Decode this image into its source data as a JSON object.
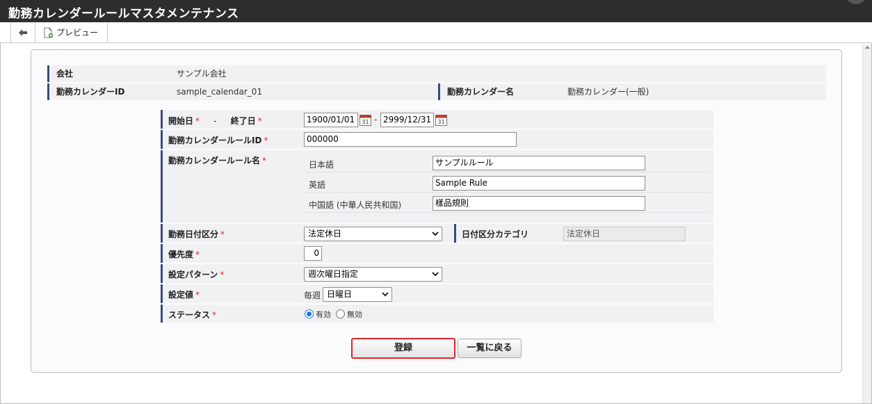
{
  "app": {
    "title": "勤務カレンダールールマスタメンテナンス"
  },
  "toolbar": {
    "back_icon": "arrow-left-icon",
    "preview_label": "プレビュー",
    "preview_icon": "document-add-icon"
  },
  "info": {
    "company_label": "会社",
    "company_value": "サンプル会社",
    "calendar_id_label": "勤務カレンダーID",
    "calendar_id_value": "sample_calendar_01",
    "calendar_name_label": "勤務カレンダー名",
    "calendar_name_value": "勤務カレンダー(一般)"
  },
  "form": {
    "start_label": "開始日",
    "range_sep": "-",
    "end_label": "終了日",
    "required_mark": "*",
    "start_date": "1900/01/01",
    "end_date": "2999/12/31",
    "date_dash": "-",
    "calendar_icon_text": "31",
    "rule_id_label": "勤務カレンダールールID",
    "rule_id_value": "000000",
    "rule_name_label": "勤務カレンダールール名",
    "names": [
      {
        "lang": "日本語",
        "value": "サンプルルール"
      },
      {
        "lang": "英語",
        "value": "Sample Rule"
      },
      {
        "lang": "中国語 (中華人民共和国)",
        "value": "樣品規則"
      }
    ],
    "date_type_label": "勤務日付区分",
    "date_type_value": "法定休日",
    "date_category_label": "日付区分カテゴリ",
    "date_category_value": "法定休日",
    "priority_label": "優先度",
    "priority_value": "0",
    "pattern_label": "設定パターン",
    "pattern_value": "週次曜日指定",
    "setting_label": "設定値",
    "setting_prefix": "毎週",
    "setting_value": "日曜日",
    "status_label": "ステータス",
    "status_options": [
      "有効",
      "無効"
    ],
    "status_selected": "有効"
  },
  "buttons": {
    "register": "登録",
    "back_to_list": "一覧に戻る"
  },
  "colors": {
    "titlebar": "#2d2d2d",
    "accent_bar": "#3a4a7a",
    "required": "#d9262a",
    "highlight": "#e0232a",
    "radio": "#1a73e8"
  }
}
